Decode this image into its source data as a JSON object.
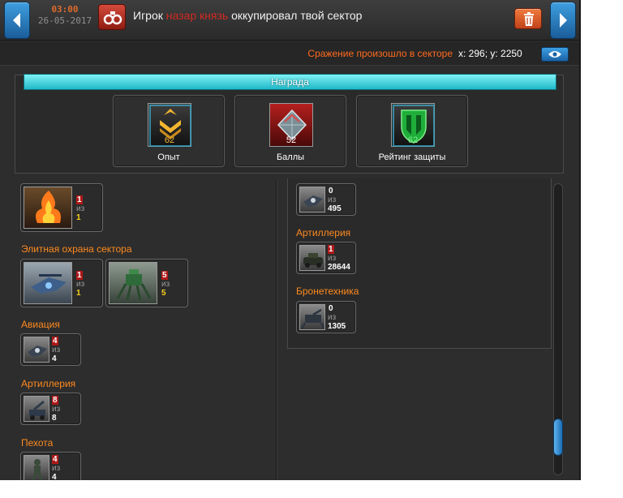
{
  "header": {
    "time": "03:00",
    "date": "26-05-2017",
    "title_prefix": "Игрок",
    "player_name": "назар князь",
    "title_suffix": "оккупировал твой сектор",
    "delete_icon": "trash-icon",
    "event_icon": "handcuffs-icon"
  },
  "battle": {
    "label": "Сражение произошло в секторе",
    "coords": "x: 296; y: 2250",
    "view_icon": "eye-icon"
  },
  "reward": {
    "title": "Награда",
    "items": [
      {
        "label": "Опыт",
        "value": "62",
        "icon": "rank-chevron-icon"
      },
      {
        "label": "Баллы",
        "value": "52",
        "icon": "diamond-points-icon"
      },
      {
        "label": "Рейтинг защиты",
        "value": "62",
        "icon": "shield-rating-icon"
      }
    ]
  },
  "left": {
    "top_unit": {
      "current": "1",
      "of": "из",
      "total": "1"
    },
    "sections": [
      {
        "title": "Элитная охрана сектора",
        "units": [
          {
            "current": "1",
            "of": "из",
            "total": "1"
          },
          {
            "current": "5",
            "of": "из",
            "total": "5"
          }
        ]
      },
      {
        "title": "Авиация",
        "units": [
          {
            "current": "4",
            "of": "из",
            "total": "4"
          }
        ]
      },
      {
        "title": "Артиллерия",
        "units": [
          {
            "current": "8",
            "of": "из",
            "total": "8"
          }
        ]
      },
      {
        "title": "Пехота",
        "units": [
          {
            "current": "4",
            "of": "из",
            "total": "4"
          }
        ]
      }
    ]
  },
  "right": {
    "top_unit": {
      "current": "0",
      "of": "из",
      "total": "495"
    },
    "sections": [
      {
        "title": "Артиллерия",
        "units": [
          {
            "current": "1",
            "of": "из",
            "total": "28644"
          }
        ]
      },
      {
        "title": "Бронетехника",
        "units": [
          {
            "current": "0",
            "of": "из",
            "total": "1305"
          }
        ]
      }
    ]
  },
  "colors": {
    "accent_orange": "#ff8a1e",
    "player_red": "#d02b22",
    "reward_cyan": "#20b8c8",
    "nav_blue": "#1a5d9a"
  }
}
